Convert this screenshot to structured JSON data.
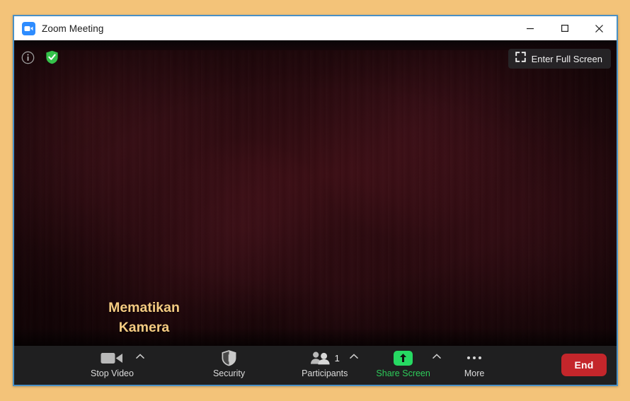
{
  "page": {
    "background_color": "#f3c379",
    "window_border_color": "#4a90c4"
  },
  "titlebar": {
    "app_icon": "zoom-camera-icon",
    "title": "Zoom Meeting",
    "controls": [
      {
        "name": "minimize",
        "glyph": "minimize-icon"
      },
      {
        "name": "maximize",
        "glyph": "maximize-icon"
      },
      {
        "name": "close",
        "glyph": "close-icon"
      }
    ]
  },
  "video": {
    "overlay_icons": [
      {
        "name": "meeting-information",
        "icon": "info-circle-icon"
      },
      {
        "name": "encryption-status",
        "icon": "green-shield-check-icon",
        "color": "#3bc14a"
      }
    ],
    "fullscreen_button": {
      "label": "Enter Full Screen",
      "icon": "expand-corners-icon"
    },
    "feed_description": "dark room camera feed"
  },
  "annotation": {
    "text": "Mematikan\nKamera",
    "color": "#f5cb82",
    "arrow": "down-arrow-icon",
    "points_to": "Stop Video"
  },
  "toolbar": {
    "background_color": "#1f1f20",
    "items": [
      {
        "name": "stop-video",
        "label": "Stop Video",
        "icon": "video-camera-icon",
        "has_caret": true,
        "label_color": "#dcdcdc"
      },
      {
        "name": "security",
        "label": "Security",
        "icon": "shield-icon",
        "has_caret": false,
        "label_color": "#dcdcdc"
      },
      {
        "name": "participants",
        "label": "Participants",
        "icon": "people-icon",
        "count": "1",
        "has_caret": true,
        "label_color": "#dcdcdc"
      },
      {
        "name": "share-screen",
        "label": "Share Screen",
        "icon": "green-up-arrow-icon",
        "has_caret": true,
        "label_color": "#2ecc5a",
        "icon_background": "#26d962"
      },
      {
        "name": "more",
        "label": "More",
        "icon": "ellipsis-icon",
        "has_caret": false,
        "label_color": "#dcdcdc"
      }
    ],
    "end_button": {
      "label": "End",
      "background_color": "#c4262b",
      "text_color": "#ffffff"
    }
  }
}
